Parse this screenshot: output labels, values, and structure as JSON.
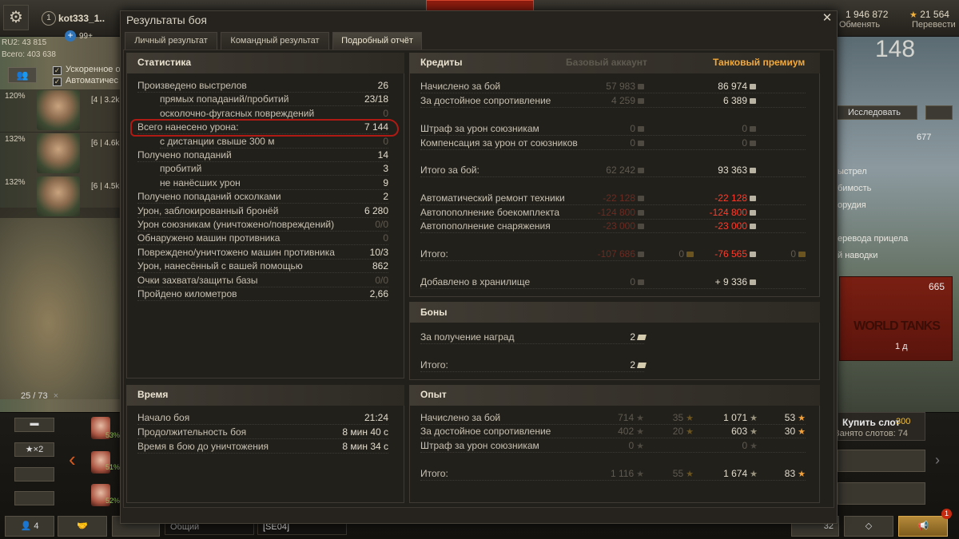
{
  "background": {
    "username": "kot333_1..",
    "user_badge": "1",
    "rating_ru": "RU2: 43 815",
    "rating_all": "Всего: 403 638",
    "plus_label": "99+",
    "checkbox1_label": "Ускоренное о",
    "checkbox2_label": "Автоматичес",
    "crew": [
      {
        "pct": "120%",
        "level": "[4 | 3.2k"
      },
      {
        "pct": "132%",
        "level": "[6 | 4.6k"
      },
      {
        "pct": "132%",
        "level": "[6 | 4.5k"
      }
    ],
    "counter": "25 / 73",
    "counter_close": "×",
    "credits": "1 946 872",
    "credits_label": "Обменять",
    "gold": "21 564",
    "gold_label": "Перевести",
    "right_big": "148",
    "research_btn": "Исследовать",
    "right_value": "677",
    "right_lines": [
      "ыстрел",
      "бимость",
      "орудия",
      "еревода прицела",
      "й наводки"
    ],
    "banner_value": "665",
    "banner_logo": "WORLD TANKS",
    "banner_time": "1 д",
    "multiplier": "★×2",
    "slots": [
      "53%",
      "51%",
      "52%"
    ],
    "buy_slot": "Купить слот",
    "buy_slot_price": "300",
    "busy_slots": "Занято слотов: 74",
    "platoon_count": "4",
    "chat_general": "Общий",
    "chat_clan": "[SE04]",
    "right_counter": "32",
    "notif": "1"
  },
  "dialog": {
    "title": "Результаты боя",
    "tabs": [
      "Личный результат",
      "Командный результат",
      "Подробный отчёт"
    ],
    "active_tab": 2,
    "stats": {
      "title": "Статистика",
      "rows": [
        {
          "label": "Произведено выстрелов",
          "value": "26",
          "indent": false,
          "dim": false
        },
        {
          "label": "прямых попаданий/пробитий",
          "value": "23/18",
          "indent": true,
          "dim": false
        },
        {
          "label": "осколочно-фугасных повреждений",
          "value": "0",
          "indent": true,
          "dim": true
        },
        {
          "label": "Всего нанесено урона:",
          "value": "7 144",
          "indent": false,
          "dim": false
        },
        {
          "label": "с дистанции свыше 300 м",
          "value": "0",
          "indent": true,
          "dim": true
        },
        {
          "label": "Получено попаданий",
          "value": "14",
          "indent": false,
          "dim": false
        },
        {
          "label": "пробитий",
          "value": "3",
          "indent": true,
          "dim": false
        },
        {
          "label": "не нанёсших урон",
          "value": "9",
          "indent": true,
          "dim": false
        },
        {
          "label": "Получено попаданий осколками",
          "value": "2",
          "indent": false,
          "dim": false
        },
        {
          "label": "Урон, заблокированный бронёй",
          "value": "6 280",
          "indent": false,
          "dim": false
        },
        {
          "label": "Урон союзникам (уничтожено/повреждений)",
          "value": "0/0",
          "indent": false,
          "dim": true
        },
        {
          "label": "Обнаружено машин противника",
          "value": "0",
          "indent": false,
          "dim": true
        },
        {
          "label": "Повреждено/уничтожено машин противника",
          "value": "10/3",
          "indent": false,
          "dim": false
        },
        {
          "label": "Урон, нанесённый с вашей помощью",
          "value": "862",
          "indent": false,
          "dim": false
        },
        {
          "label": "Очки захвата/защиты базы",
          "value": "0/0",
          "indent": false,
          "dim": true
        },
        {
          "label": "Пройдено километров",
          "value": "2,66",
          "indent": false,
          "dim": false
        }
      ]
    },
    "time": {
      "title": "Время",
      "rows": [
        {
          "label": "Начало боя",
          "value": "21:24"
        },
        {
          "label": "Продолжительность боя",
          "value": "8 мин 40 с"
        },
        {
          "label": "Время в бою до уничтожения",
          "value": "8 мин 34 с"
        }
      ]
    },
    "credits": {
      "title": "Кредиты",
      "col_basic": "Базовый аккаунт",
      "col_premium": "Танковый премиум",
      "rows": [
        {
          "label": "Начислено за бой",
          "basic": "57 983",
          "premium": "86 974",
          "neg": false
        },
        {
          "label": "За достойное сопротивление",
          "basic": "4 259",
          "premium": "6 389",
          "neg": false
        },
        {
          "label": "Штраф за урон союзникам",
          "basic": "0",
          "premium": "0",
          "neg": false,
          "dim": true
        },
        {
          "label": "Компенсация за урон от союзников",
          "basic": "0",
          "premium": "0",
          "neg": false,
          "dim": true
        },
        {
          "label": "Итого за бой:",
          "basic": "62 242",
          "premium": "93 363",
          "neg": false
        },
        {
          "label": "Автоматический ремонт техники",
          "basic": "-22 128",
          "premium": "-22 128",
          "neg": true
        },
        {
          "label": "Автопополнение боекомплекта",
          "basic": "-124 800",
          "premium": "-124 800",
          "neg": true
        },
        {
          "label": "Автопополнение снаряжения",
          "basic": "-23 000",
          "premium": "-23 000",
          "neg": true
        },
        {
          "label": "Итого:",
          "basic": "-107 686",
          "basic_gold": "0",
          "premium": "-76 565",
          "premium_gold": "0",
          "neg": true
        },
        {
          "label": "Добавлено в хранилище",
          "basic": "0",
          "premium": "+ 9 336",
          "neg": false
        }
      ]
    },
    "bonds": {
      "title": "Боны",
      "rows": [
        {
          "label": "За получение наград",
          "value": "2"
        },
        {
          "label": "Итого:",
          "value": "2"
        }
      ]
    },
    "xp": {
      "title": "Опыт",
      "rows": [
        {
          "label": "Начислено за бой",
          "basic": "714",
          "basic_free": "35",
          "premium": "1 071",
          "premium_free": "53"
        },
        {
          "label": "За достойное сопротивление",
          "basic": "402",
          "basic_free": "20",
          "premium": "603",
          "premium_free": "30"
        },
        {
          "label": "Штраф за урон союзникам",
          "basic": "0",
          "basic_free": "",
          "premium": "0",
          "premium_free": ""
        },
        {
          "label": "Итого:",
          "basic": "1 116",
          "basic_free": "55",
          "premium": "1 674",
          "premium_free": "83"
        }
      ]
    }
  }
}
